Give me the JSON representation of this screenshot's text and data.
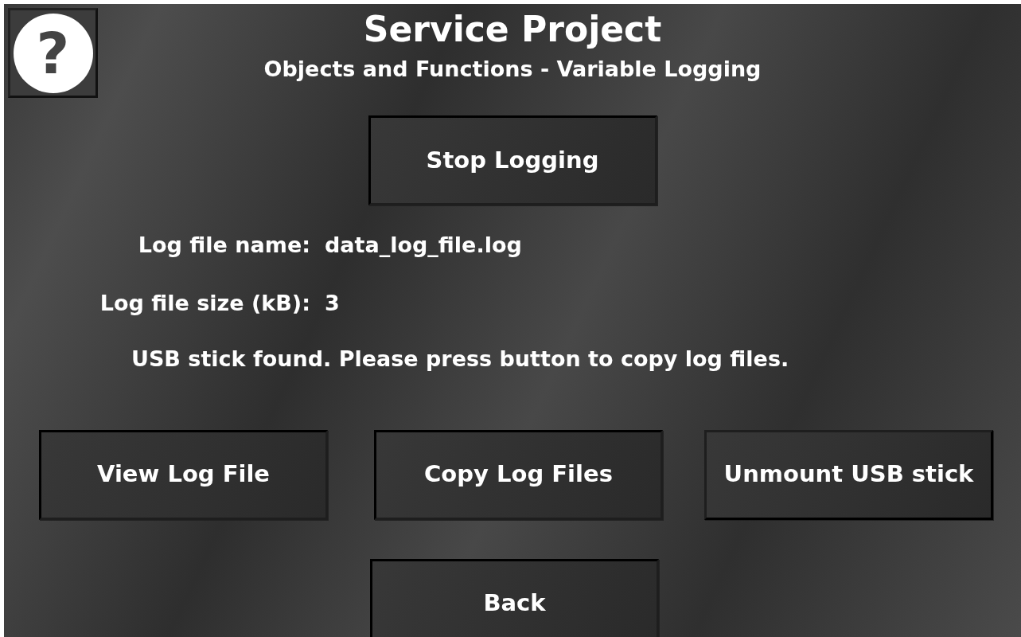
{
  "help_button": {
    "label": "?"
  },
  "title": "Service Project",
  "subtitle": "Objects and Functions - Variable Logging",
  "logging_button": {
    "label": "Stop Logging"
  },
  "info": [
    {
      "label": "Log file name:",
      "value": "data_log_file.log"
    },
    {
      "label": "Log file size (kB):",
      "value": "3"
    }
  ],
  "message": "USB stick found. Please press button to copy log files.",
  "action_buttons": [
    {
      "label": "View Log File"
    },
    {
      "label": "Copy Log Files"
    },
    {
      "label": "Unmount USB stick"
    }
  ],
  "back_button": {
    "label": "Back"
  }
}
